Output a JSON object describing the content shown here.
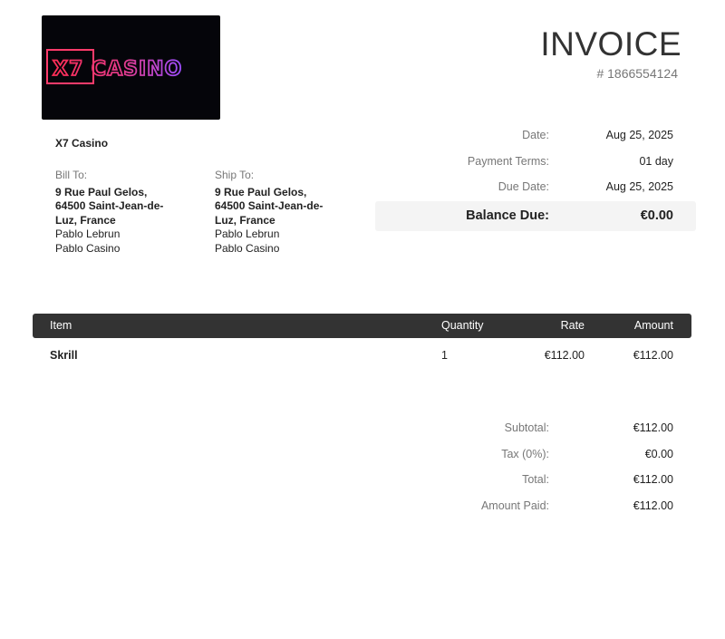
{
  "company": {
    "logo_text": "X7 CASINO",
    "name": "X7 Casino"
  },
  "invoice": {
    "title": "INVOICE",
    "number": "# 1866554124"
  },
  "bill_to": {
    "label": "Bill To:",
    "address_lines": [
      "9 Rue Paul Gelos,",
      "64500 Saint-Jean-de-",
      "Luz, France"
    ],
    "name": "Pablo Lebrun",
    "company": "Pablo Casino"
  },
  "ship_to": {
    "label": "Ship To:",
    "address_lines": [
      "9 Rue Paul Gelos,",
      "64500 Saint-Jean-de-",
      "Luz, France"
    ],
    "name": "Pablo Lebrun",
    "company": "Pablo Casino"
  },
  "meta": [
    {
      "label": "Date:",
      "value": "Aug 25, 2025"
    },
    {
      "label": "Payment Terms:",
      "value": "01 day"
    },
    {
      "label": "Due Date:",
      "value": "Aug 25, 2025"
    }
  ],
  "balance_due": {
    "label": "Balance Due:",
    "value": "€0.00"
  },
  "table": {
    "headers": {
      "item": "Item",
      "quantity": "Quantity",
      "rate": "Rate",
      "amount": "Amount"
    },
    "rows": [
      {
        "item": "Skrill",
        "quantity": "1",
        "rate": "€112.00",
        "amount": "€112.00"
      }
    ]
  },
  "totals": [
    {
      "label": "Subtotal:",
      "value": "€112.00"
    },
    {
      "label": "Tax (0%):",
      "value": "€0.00"
    },
    {
      "label": "Total:",
      "value": "€112.00"
    },
    {
      "label": "Amount Paid:",
      "value": "€112.00"
    }
  ],
  "colors": {
    "logo_bg": "#05050a",
    "logo_red": "#e8284f",
    "logo_purple": "#b43cf0",
    "header_bar": "#333333",
    "balance_bg": "#f4f4f4"
  }
}
